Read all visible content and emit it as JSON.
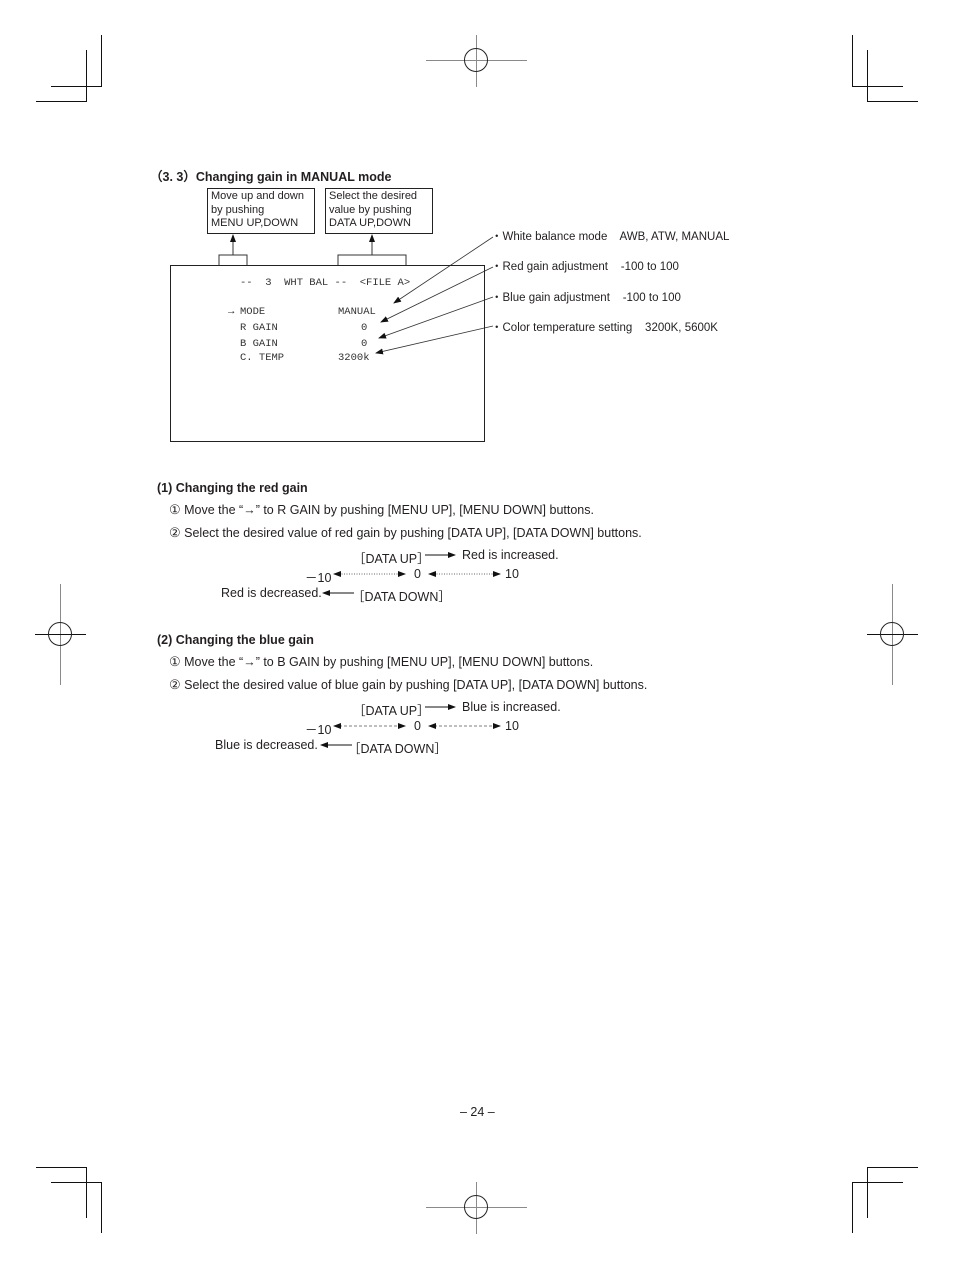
{
  "section": {
    "number": "（3. 3）",
    "title": "Changing gain in MANUAL mode"
  },
  "notes": {
    "menu": [
      "Move up and down",
      "by pushing",
      "MENU UP,DOWN"
    ],
    "data": [
      "Select the desired",
      "value by pushing",
      "DATA UP,DOWN"
    ]
  },
  "screen": {
    "header": "--  3  WHT BAL --  <FILE A>",
    "cursor": "→",
    "rows": [
      {
        "label": "MODE",
        "value": "MANUAL"
      },
      {
        "label": "R GAIN",
        "value": "0"
      },
      {
        "label": "B GAIN",
        "value": "0"
      },
      {
        "label": "C. TEMP",
        "value": "3200k"
      }
    ]
  },
  "callouts": [
    {
      "bullet": "・",
      "label": "White balance mode",
      "range": "AWB, ATW, MANUAL"
    },
    {
      "bullet": "・",
      "label": "Red gain adjustment",
      "range": "-100 to 100"
    },
    {
      "bullet": "・",
      "label": "Blue gain adjustment",
      "range": "-100 to 100"
    },
    {
      "bullet": "・",
      "label": "Color temperature setting",
      "range": "3200K, 5600K"
    }
  ],
  "red": {
    "heading": "(1) Changing the red gain",
    "step1_num": "①",
    "step1": "Move the “→” to R GAIN by pushing [MENU UP], [MENU DOWN] buttons.",
    "step2_num": "②",
    "step2": "Select the desired value of red gain by pushing [DATA UP], [DATA DOWN] buttons.",
    "up_key": "［DATA UP］",
    "up_text": "Red is increased.",
    "min": "－10",
    "mid": "0",
    "max": "10",
    "down_text": "Red is decreased.",
    "down_key": "［DATA DOWN］"
  },
  "blue": {
    "heading": "(2) Changing the blue gain",
    "step1_num": "①",
    "step1": "Move the “→” to B GAIN by pushing [MENU UP], [MENU DOWN] buttons.",
    "step2_num": "②",
    "step2": "Select the desired value of blue gain by pushing [DATA UP], [DATA DOWN] buttons.",
    "up_key": "［DATA UP］",
    "up_text": "Blue is increased.",
    "min": "－10",
    "mid": "0",
    "max": "10",
    "down_text": "Blue is decreased.",
    "down_key": "［DATA DOWN］"
  },
  "footer": {
    "page_number": "– 24 –"
  }
}
